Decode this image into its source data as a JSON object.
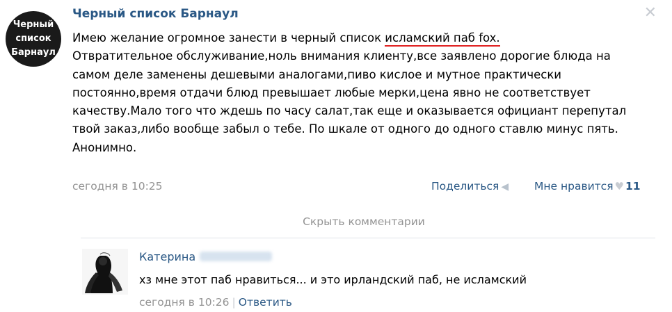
{
  "post": {
    "group_name": "Черный список Барнаул",
    "avatar_lines": [
      "Черный",
      "список",
      "Барнаул"
    ],
    "intro": "Имею желание огромное занести в черный список ",
    "highlight": "исламский паб fox.",
    "body": "Отвратительное обслуживание,ноль внимания клиенту,все заявлено дорогие блюда на самом деле заменены дешевыми аналогами,пиво кислое и мутное практически постоянно,время отдачи блюд превышает любые мерки,цена явно не соответствует качеству.Мало того что ждешь по часу салат,так еще и оказывается официант перепутал твой заказ,либо вообще забыл о тебе. По шкале от одного до одного ставлю минус пять.",
    "sign": "Анонимно.",
    "time": "сегодня в 10:25",
    "share_label": "Поделиться",
    "like_label": "Мне нравится",
    "like_count": "11",
    "icons": {
      "close": "close-icon",
      "apple": "apple-icon",
      "share": "megaphone-icon",
      "like": "heart-icon"
    }
  },
  "comments_toggle": "Скрыть комментарии",
  "comment": {
    "author": "Катерина",
    "text": "хз мне этот паб нравиться... и это ирландский паб, не исламский",
    "time": "сегодня в 10:26",
    "separator": "|",
    "reply_label": "Ответить"
  },
  "colors": {
    "link": "#2a5885",
    "muted": "#939393",
    "highlight_underline": "#e02020"
  }
}
